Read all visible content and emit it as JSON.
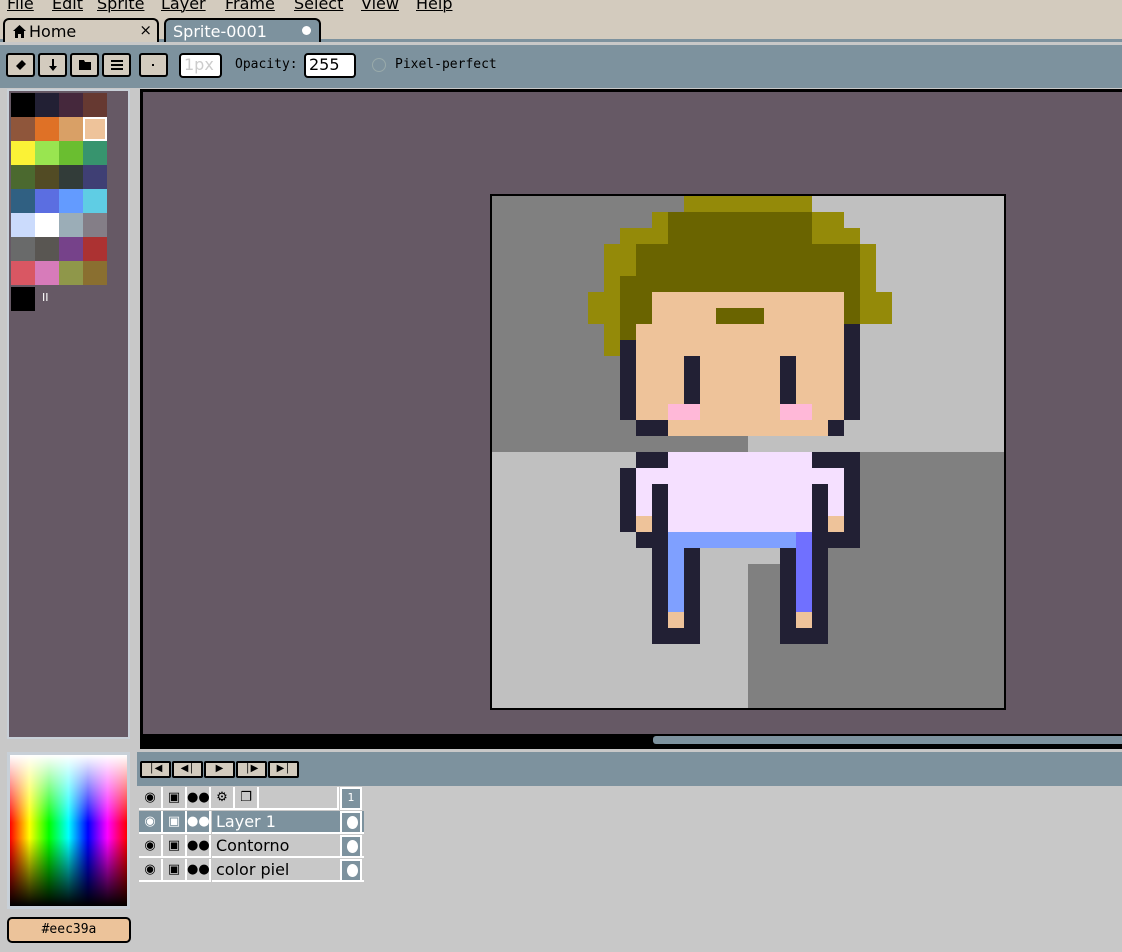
{
  "menu": {
    "items": [
      "File",
      "Edit",
      "Sprite",
      "Layer",
      "Frame",
      "Select",
      "View",
      "Help"
    ]
  },
  "tabs": [
    {
      "label": "Home",
      "icon": "home-icon",
      "close": "×"
    },
    {
      "label": "Sprite-0001",
      "icon": "modified-dot-icon"
    }
  ],
  "toolbar": {
    "brush_size_placeholder": "1px",
    "opacity_label": "Opacity:",
    "opacity_value": "255",
    "pixel_perfect_label": "Pixel-perfect"
  },
  "palette": {
    "colors": [
      "#000000",
      "#222034",
      "#45283c",
      "#663931",
      "#8f563b",
      "#df7126",
      "#d9a066",
      "#eec39a",
      "#fbf236",
      "#99e550",
      "#6abe30",
      "#37946e",
      "#4b692f",
      "#524b24",
      "#323c39",
      "#3f3f74",
      "#306082",
      "#5b6ee1",
      "#639bff",
      "#5fcde4",
      "#cbdbfc",
      "#ffffff",
      "#9badb7",
      "#847e87",
      "#696a6a",
      "#595652",
      "#76428a",
      "#ac3232",
      "#d95763",
      "#d77bba",
      "#8f974a",
      "#8a6f30"
    ],
    "info": "II"
  },
  "color_field": {
    "hex": "#eec39a",
    "bg_color": "#eec39a"
  },
  "timeline": {
    "frame_header": "1",
    "layers": [
      {
        "name": "Layer 1",
        "selected": true
      },
      {
        "name": "Contorno",
        "selected": false
      },
      {
        "name": "color piel",
        "selected": false
      }
    ]
  }
}
